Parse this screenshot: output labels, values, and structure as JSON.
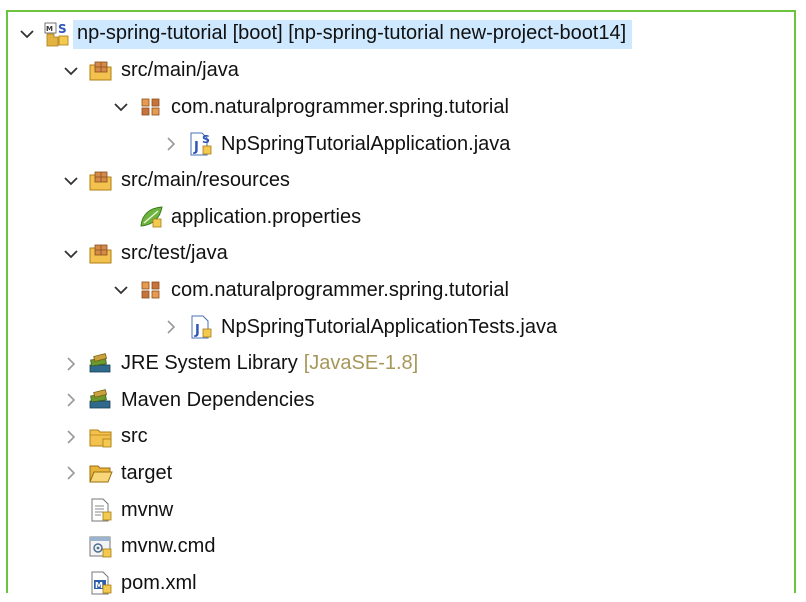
{
  "tree": {
    "items": [
      {
        "label": "np-spring-tutorial [boot] [np-spring-tutorial new-project-boot14]",
        "decoration": "",
        "level": 0,
        "expand": "expanded",
        "icon": "spring-boot-project-icon",
        "selected": true
      },
      {
        "label": "src/main/java",
        "decoration": "",
        "level": 1,
        "expand": "expanded",
        "icon": "source-folder-icon"
      },
      {
        "label": "com.naturalprogrammer.spring.tutorial",
        "decoration": "",
        "level": 2,
        "expand": "expanded",
        "icon": "package-icon"
      },
      {
        "label": "NpSpringTutorialApplication.java",
        "decoration": "",
        "level": 3,
        "expand": "collapsed",
        "icon": "spring-java-file-icon"
      },
      {
        "label": "src/main/resources",
        "decoration": "",
        "level": 1,
        "expand": "expanded",
        "icon": "source-folder-icon"
      },
      {
        "label": "application.properties",
        "decoration": "",
        "level": 2,
        "expand": "none",
        "icon": "spring-properties-icon"
      },
      {
        "label": "src/test/java",
        "decoration": "",
        "level": 1,
        "expand": "expanded",
        "icon": "source-folder-icon"
      },
      {
        "label": "com.naturalprogrammer.spring.tutorial",
        "decoration": "",
        "level": 2,
        "expand": "expanded",
        "icon": "package-icon"
      },
      {
        "label": "NpSpringTutorialApplicationTests.java",
        "decoration": "",
        "level": 3,
        "expand": "collapsed",
        "icon": "java-test-file-icon"
      },
      {
        "label": "JRE System Library",
        "decoration": "[JavaSE-1.8]",
        "level": 1,
        "expand": "collapsed",
        "icon": "library-icon"
      },
      {
        "label": "Maven Dependencies",
        "decoration": "",
        "level": 1,
        "expand": "collapsed",
        "icon": "library-icon"
      },
      {
        "label": "src",
        "decoration": "",
        "level": 1,
        "expand": "collapsed",
        "icon": "folder-icon"
      },
      {
        "label": "target",
        "decoration": "",
        "level": 1,
        "expand": "collapsed",
        "icon": "open-folder-icon"
      },
      {
        "label": "mvnw",
        "decoration": "",
        "level": 1,
        "expand": "none",
        "icon": "text-file-icon"
      },
      {
        "label": "mvnw.cmd",
        "decoration": "",
        "level": 1,
        "expand": "none",
        "icon": "cmd-file-icon"
      },
      {
        "label": "pom.xml",
        "decoration": "",
        "level": 1,
        "expand": "none",
        "icon": "maven-pom-icon"
      }
    ]
  },
  "colors": {
    "frame_border": "#6bc43d",
    "selection": "#cde8ff",
    "decoration_text": "#a7975a"
  }
}
